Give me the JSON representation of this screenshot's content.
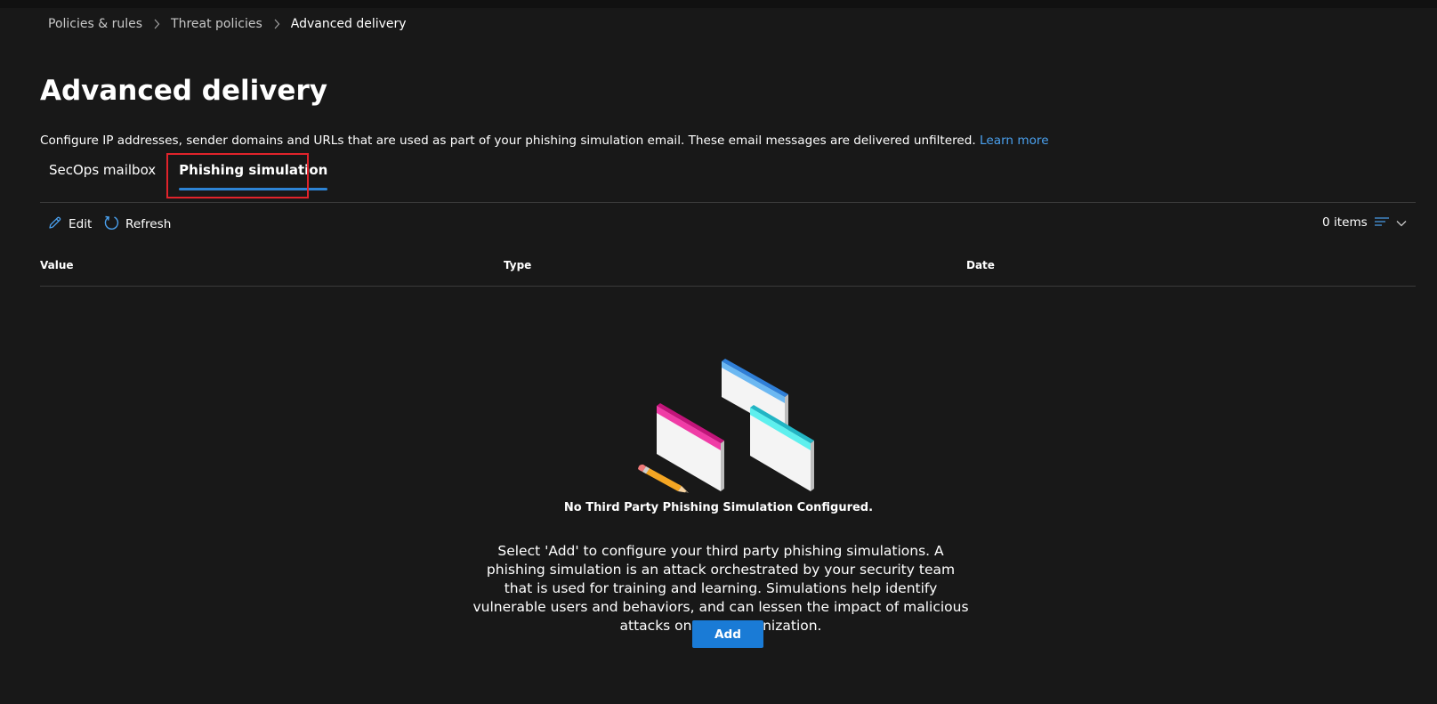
{
  "breadcrumb": {
    "items": [
      "Policies & rules",
      "Threat policies",
      "Advanced delivery"
    ]
  },
  "page": {
    "title": "Advanced delivery",
    "description": "Configure IP addresses, sender domains and URLs that are used as part of your phishing simulation email. These email messages are delivered unfiltered.",
    "learn_more": "Learn more"
  },
  "tabs": [
    {
      "label": "SecOps mailbox",
      "selected": false
    },
    {
      "label": "Phishing simulation",
      "selected": true
    }
  ],
  "toolbar": {
    "edit_label": "Edit",
    "refresh_label": "Refresh",
    "items_count": "0 items"
  },
  "table": {
    "columns": [
      "Value",
      "Type",
      "Date"
    ]
  },
  "empty_state": {
    "title": "No Third Party Phishing Simulation Configured.",
    "body": "Select 'Add' to configure your third party phishing simulations. A phishing simulation is an attack orchestrated by your security team that is used for training and learning. Simulations help identify vulnerable users and behaviors, and can lessen the impact of malicious attacks on your organization.",
    "add_label": "Add"
  },
  "colors": {
    "background": "#181818",
    "accent": "#1a7bd6",
    "link": "#4aa0ee",
    "highlight_border": "#e0232b"
  },
  "icons": [
    "chevron-right-icon",
    "pencil-icon",
    "refresh-icon",
    "sort-lines-icon",
    "chevron-down-icon"
  ]
}
